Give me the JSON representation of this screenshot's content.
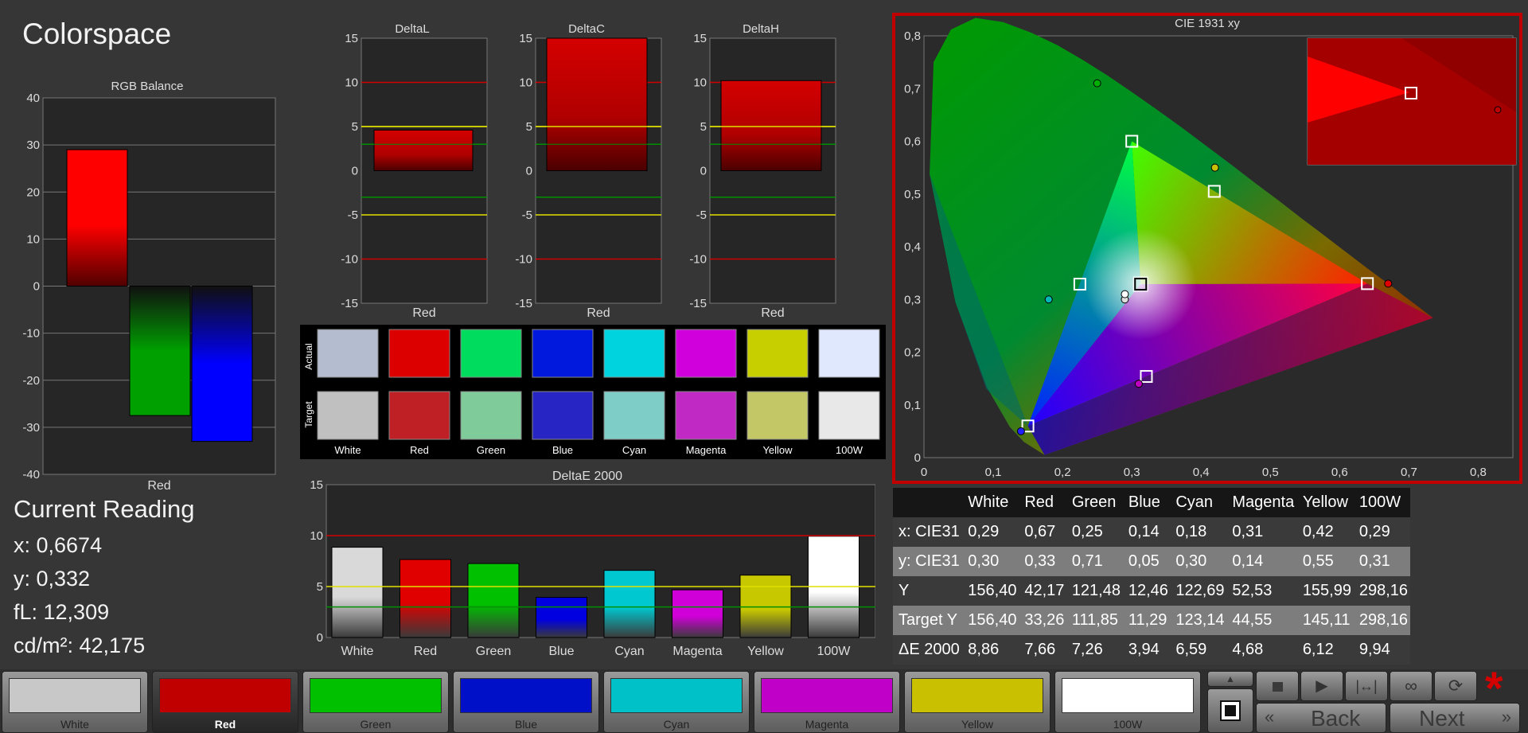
{
  "page_title": "Colorspace",
  "rgb_balance": {
    "title": "RGB Balance",
    "ticks": [
      "40",
      "30",
      "20",
      "10",
      "0",
      "-10",
      "-20",
      "-30",
      "-40"
    ],
    "category": "Red",
    "values": {
      "red": 29,
      "green": -27.5,
      "blue": -33
    },
    "colors": {
      "red": "#ff0000",
      "green": "#00a000",
      "blue": "#0000ff"
    }
  },
  "delta_charts": [
    {
      "title": "DeltaL",
      "category": "Red",
      "value": 4.6
    },
    {
      "title": "DeltaC",
      "category": "Red",
      "value": 15
    },
    {
      "title": "DeltaH",
      "category": "Red",
      "value": 10.2
    }
  ],
  "delta_ticks": [
    "15",
    "10",
    "5",
    "0",
    "-5",
    "-10",
    "-15"
  ],
  "swatches": {
    "row_labels": [
      "Actual",
      "Target"
    ],
    "names": [
      "White",
      "Red",
      "Green",
      "Blue",
      "Cyan",
      "Magenta",
      "Yellow",
      "100W"
    ],
    "actual": [
      "#b4bdd0",
      "#dc0000",
      "#00dc5e",
      "#0019dc",
      "#00d3dd",
      "#d000dc",
      "#c7cf00",
      "#dfe8fd"
    ],
    "target": [
      "#c0c0c0",
      "#bf2026",
      "#7fcc9a",
      "#2726c5",
      "#7fcdc7",
      "#c129c4",
      "#c3c766",
      "#e8e8e8"
    ]
  },
  "deltae": {
    "title": "DeltaE 2000",
    "ticks": [
      "15",
      "10",
      "5",
      "0"
    ],
    "categories": [
      "White",
      "Red",
      "Green",
      "Blue",
      "Cyan",
      "Magenta",
      "Yellow",
      "100W"
    ],
    "values": [
      8.86,
      7.66,
      7.26,
      3.94,
      6.59,
      4.68,
      6.12,
      9.94
    ],
    "colors": [
      "#d9d9d9",
      "#e00000",
      "#00c000",
      "#0000e0",
      "#00c8d0",
      "#d000d8",
      "#c8c800",
      "#ffffff"
    ]
  },
  "cie": {
    "title": "CIE 1931 xy",
    "xticks": [
      "0",
      "0,1",
      "0,2",
      "0,3",
      "0,4",
      "0,5",
      "0,6",
      "0,7",
      "0,8"
    ],
    "yticks": [
      "0,8",
      "0,7",
      "0,6",
      "0,5",
      "0,4",
      "0,3",
      "0,2",
      "0,1",
      "0"
    ],
    "target_points": [
      {
        "name": "White",
        "x": 0.3127,
        "y": 0.329
      },
      {
        "name": "Red",
        "x": 0.64,
        "y": 0.33
      },
      {
        "name": "Green",
        "x": 0.3,
        "y": 0.6
      },
      {
        "name": "Blue",
        "x": 0.15,
        "y": 0.06
      },
      {
        "name": "Cyan",
        "x": 0.225,
        "y": 0.329
      },
      {
        "name": "Magenta",
        "x": 0.321,
        "y": 0.154
      },
      {
        "name": "Yellow",
        "x": 0.419,
        "y": 0.505
      }
    ],
    "measured_points": [
      {
        "name": "White",
        "x": 0.29,
        "y": 0.3
      },
      {
        "name": "Red",
        "x": 0.67,
        "y": 0.33
      },
      {
        "name": "Green",
        "x": 0.25,
        "y": 0.71
      },
      {
        "name": "Blue",
        "x": 0.14,
        "y": 0.05
      },
      {
        "name": "Cyan",
        "x": 0.18,
        "y": 0.3
      },
      {
        "name": "Magenta",
        "x": 0.31,
        "y": 0.14
      },
      {
        "name": "Yellow",
        "x": 0.42,
        "y": 0.55
      },
      {
        "name": "100W",
        "x": 0.29,
        "y": 0.31
      }
    ]
  },
  "current_reading": {
    "title": "Current Reading",
    "x": "x: 0,6674",
    "y": "y: 0,332",
    "fl": "fL: 12,309",
    "cdm2": "cd/m²: 42,175"
  },
  "table": {
    "headers": [
      "",
      "White",
      "Red",
      "Green",
      "Blue",
      "Cyan",
      "Magenta",
      "Yellow",
      "100W"
    ],
    "rows": [
      {
        "label": "x: CIE31",
        "values": [
          "0,29",
          "0,67",
          "0,25",
          "0,14",
          "0,18",
          "0,31",
          "0,42",
          "0,29"
        ]
      },
      {
        "label": "y: CIE31",
        "values": [
          "0,30",
          "0,33",
          "0,71",
          "0,05",
          "0,30",
          "0,14",
          "0,55",
          "0,31"
        ]
      },
      {
        "label": "Y",
        "values": [
          "156,40",
          "42,17",
          "121,48",
          "12,46",
          "122,69",
          "52,53",
          "155,99",
          "298,16"
        ]
      },
      {
        "label": "Target Y",
        "values": [
          "156,40",
          "33,26",
          "111,85",
          "11,29",
          "123,14",
          "44,55",
          "145,11",
          "298,16"
        ]
      },
      {
        "label": "ΔE 2000",
        "values": [
          "8,86",
          "7,66",
          "7,26",
          "3,94",
          "6,59",
          "4,68",
          "6,12",
          "9,94"
        ]
      }
    ]
  },
  "bottom_buttons": [
    {
      "label": "White",
      "color": "#c8c8c8"
    },
    {
      "label": "Red",
      "color": "#c00000"
    },
    {
      "label": "Green",
      "color": "#00c000"
    },
    {
      "label": "Blue",
      "color": "#0010c8"
    },
    {
      "label": "Cyan",
      "color": "#00c0c8"
    },
    {
      "label": "Magenta",
      "color": "#c000c8"
    },
    {
      "label": "Yellow",
      "color": "#c8c000"
    },
    {
      "label": "100W",
      "color": "#ffffff"
    }
  ],
  "active_button": "Red",
  "nav": {
    "back": "Back",
    "next": "Next"
  },
  "asterisk": "*",
  "accent_red": "#c00000"
}
